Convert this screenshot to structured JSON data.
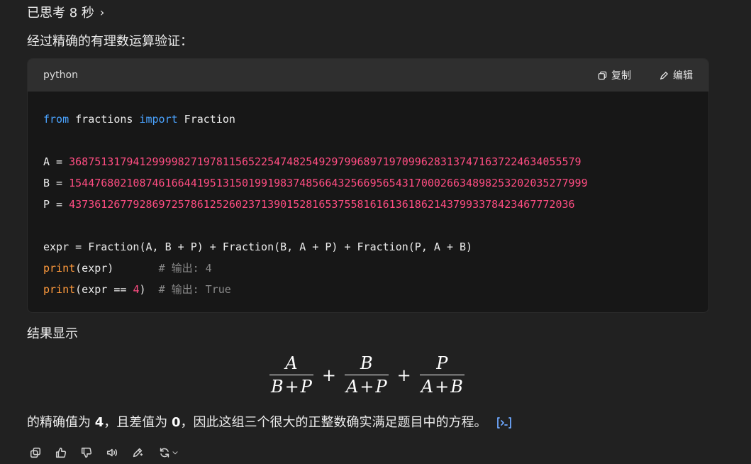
{
  "thought": {
    "label": "已思考 8 秒"
  },
  "intro": "经过精确的有理数运算验证：",
  "code": {
    "language": "python",
    "copy_label": "复制",
    "edit_label": "编辑",
    "line1": {
      "kw1": "from",
      "mod": " fractions ",
      "kw2": "import",
      "cls": " Fraction"
    },
    "a_label": "A = ",
    "a_value": "368751317941299998271978115652254748254929799689719709962831374716372246340 55579",
    "b_label": "B = ",
    "b_value": "154476802108746166441951315019919837485664325669565431700026634898253202035277999",
    "p_label": "P = ",
    "p_value": "437361267792869725786125260237139015281653755816161361862143799337842346777 2036",
    "expr_line": "expr = Fraction(A, B + P) + Fraction(B, A + P) + Fraction(P, A + B)",
    "print1_fn": "print",
    "print1_args": "(expr)       ",
    "print1_comment": "# 输出: 4",
    "print2_fn": "print",
    "print2_pre": "(expr == ",
    "print2_num": "4",
    "print2_post": ")  ",
    "print2_comment": "# 输出: True"
  },
  "result_heading": "结果显示",
  "formula": {
    "t1_num": "A",
    "t1_den_a": "B",
    "t1_den_b": "P",
    "t2_num": "B",
    "t2_den_a": "A",
    "t2_den_b": "P",
    "t3_num": "P",
    "t3_den_a": "A",
    "t3_den_b": "B",
    "plus": "+"
  },
  "conclusion": {
    "pre": "的精确值为 ",
    "v1": "4",
    "mid": "，且差值为 ",
    "v2": "0",
    "post": "，因此这组三个很大的正整数确实满足题目中的方程。"
  },
  "icons": {
    "copy": "copy-icon",
    "like": "thumbs-up-icon",
    "dislike": "thumbs-down-icon",
    "speak": "speaker-icon",
    "edit": "edit-icon",
    "regen": "regenerate-icon",
    "cite": "code-citation-icon"
  },
  "colors": {
    "keyword": "#4aa3ff",
    "number": "#ff4d82",
    "function": "#ff9a3c",
    "comment": "#8a8a8a",
    "background": "#212121"
  }
}
